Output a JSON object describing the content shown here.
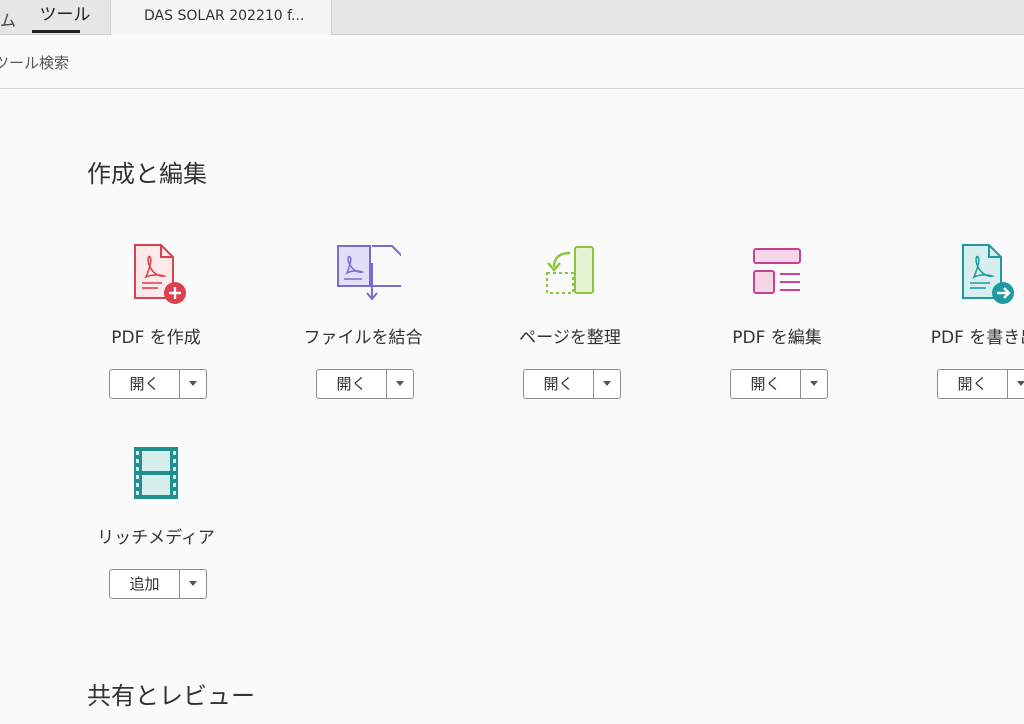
{
  "tabs": {
    "fragment": "ム",
    "tools_label": "ツール",
    "document_label": "DAS SOLAR 202210 f..."
  },
  "search": {
    "label": "ツール検索"
  },
  "sections": [
    {
      "title": "作成と編集",
      "tools": [
        {
          "label": "PDF を作成",
          "button": "開く",
          "icon": "create-pdf-icon",
          "color": "#d9414c"
        },
        {
          "label": "ファイルを結合",
          "button": "開く",
          "icon": "combine-files-icon",
          "color": "#7a6ccf"
        },
        {
          "label": "ページを整理",
          "button": "開く",
          "icon": "organize-pages-icon",
          "color": "#8cc63f"
        },
        {
          "label": "PDF を編集",
          "button": "開く",
          "icon": "edit-pdf-icon",
          "color": "#c6419a"
        },
        {
          "label": "PDF を書き出",
          "button": "開く",
          "icon": "export-pdf-icon",
          "color": "#1f9aa2"
        },
        {
          "label": "リッチメディア",
          "button": "追加",
          "icon": "rich-media-icon",
          "color": "#1f8f8f"
        }
      ]
    },
    {
      "title": "共有とレビュー"
    }
  ]
}
